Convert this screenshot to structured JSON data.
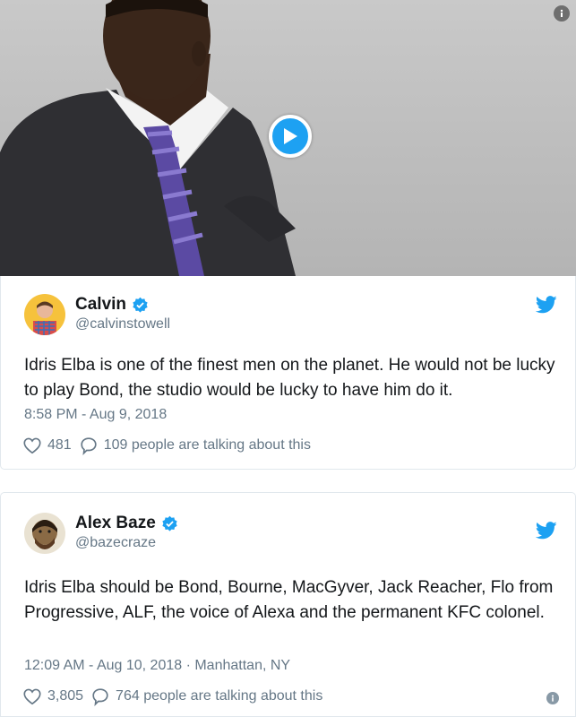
{
  "video": {
    "accent": "#1da1f2"
  },
  "tweets": [
    {
      "name": "Calvin",
      "handle": "@calvinstowell",
      "text": "Idris Elba is one of the finest men on the planet. He would not be lucky to play Bond, the studio would be lucky to have him do it.",
      "meta": "8:58 PM - Aug 9, 2018",
      "likes": "481",
      "talking": "109 people are talking about this"
    },
    {
      "name": "Alex Baze",
      "handle": "@bazecraze",
      "text": "Idris Elba should be Bond, Bourne, MacGyver, Jack Reacher, Flo from Progressive, ALF, the voice of Alexa and the permanent KFC colonel.",
      "meta": "12:09 AM - Aug 10, 2018 · Manhattan, NY",
      "likes": "3,805",
      "talking": "764 people are talking about this"
    }
  ],
  "icons": {
    "verified": "verified-badge-icon",
    "bird": "twitter-bird-icon",
    "like": "heart-icon",
    "reply": "speech-bubble-icon",
    "play": "play-icon",
    "info": "info-icon"
  },
  "colors": {
    "twitter_blue": "#1da1f2",
    "secondary_text": "#657786",
    "border": "#e1e8ed"
  }
}
